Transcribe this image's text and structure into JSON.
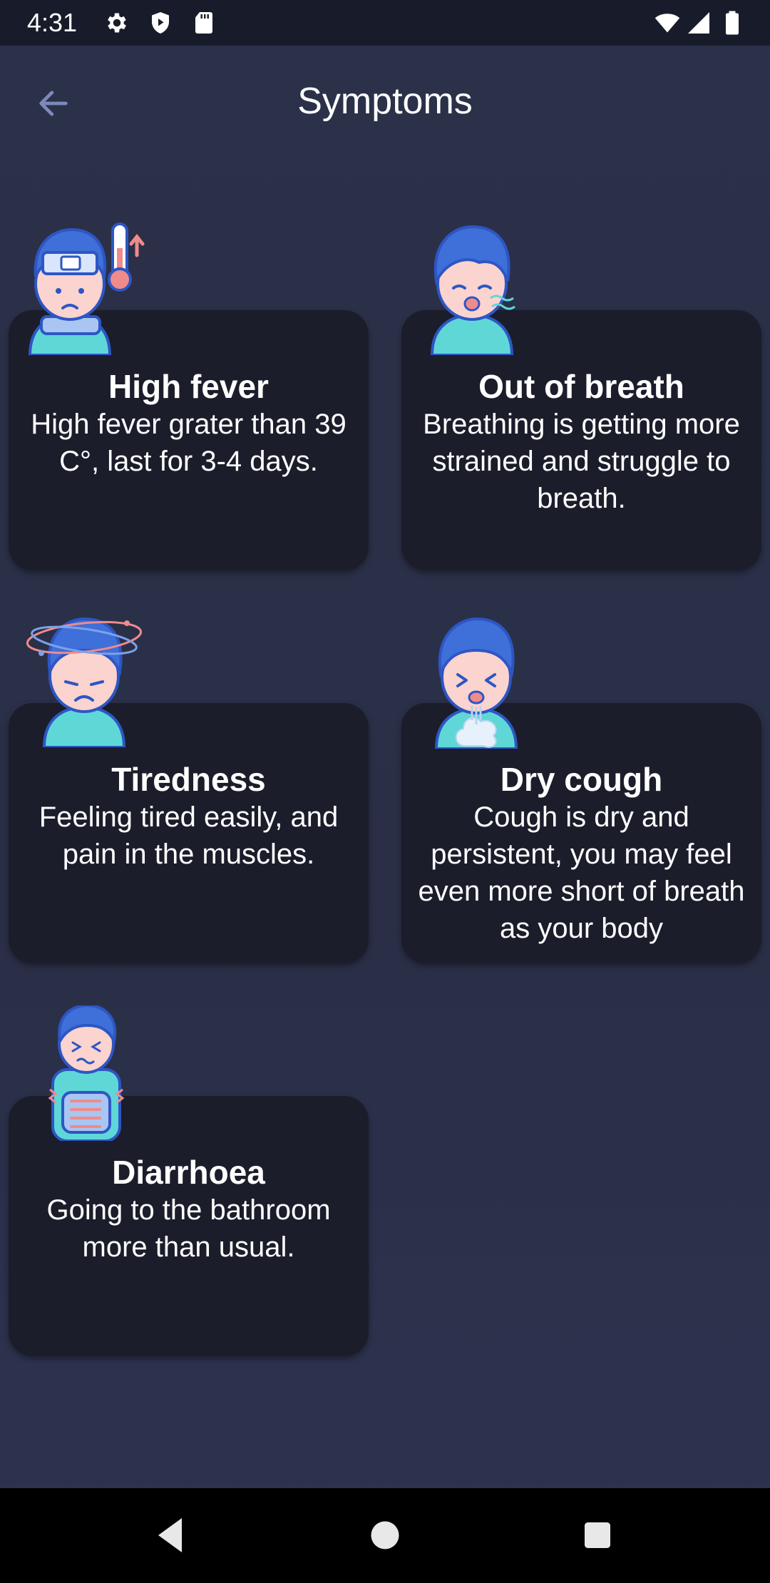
{
  "status_bar": {
    "time": "4:31",
    "icons_left": [
      "gear-icon",
      "shield-play-icon",
      "sd-card-icon"
    ],
    "icons_right": [
      "wifi-icon",
      "cellular-signal-icon",
      "battery-icon"
    ]
  },
  "app_bar": {
    "back_icon": "arrow-left-icon",
    "title": "Symptoms"
  },
  "symptoms": [
    {
      "title": "High fever",
      "description": "High fever grater than 39 C°, last for 3-4 days.",
      "illustration": "fever-boy-thermometer"
    },
    {
      "title": "Out of breath",
      "description": "Breathing is getting more strained and struggle to breath.",
      "illustration": "breathless-boy"
    },
    {
      "title": "Tiredness",
      "description": "Feeling tired easily, and pain in the muscles.",
      "illustration": "dizzy-boy"
    },
    {
      "title": "Dry cough",
      "description": "Cough is dry and persistent, you may feel even more short of breath as your body",
      "illustration": "coughing-boy"
    },
    {
      "title": "Diarrhoea",
      "description": "Going to the bathroom more than usual.",
      "illustration": "stomach-ache-boy"
    }
  ],
  "nav_bar": {
    "back": "triangle-back-icon",
    "home": "circle-home-icon",
    "recents": "square-recents-icon"
  },
  "colors": {
    "background": "#2b3149",
    "card": "#1b1d2b",
    "status_bar": "#181c2a",
    "hair": "#3f6fd8",
    "skin": "#fbd3cf",
    "shirt": "#5fd7d7"
  }
}
